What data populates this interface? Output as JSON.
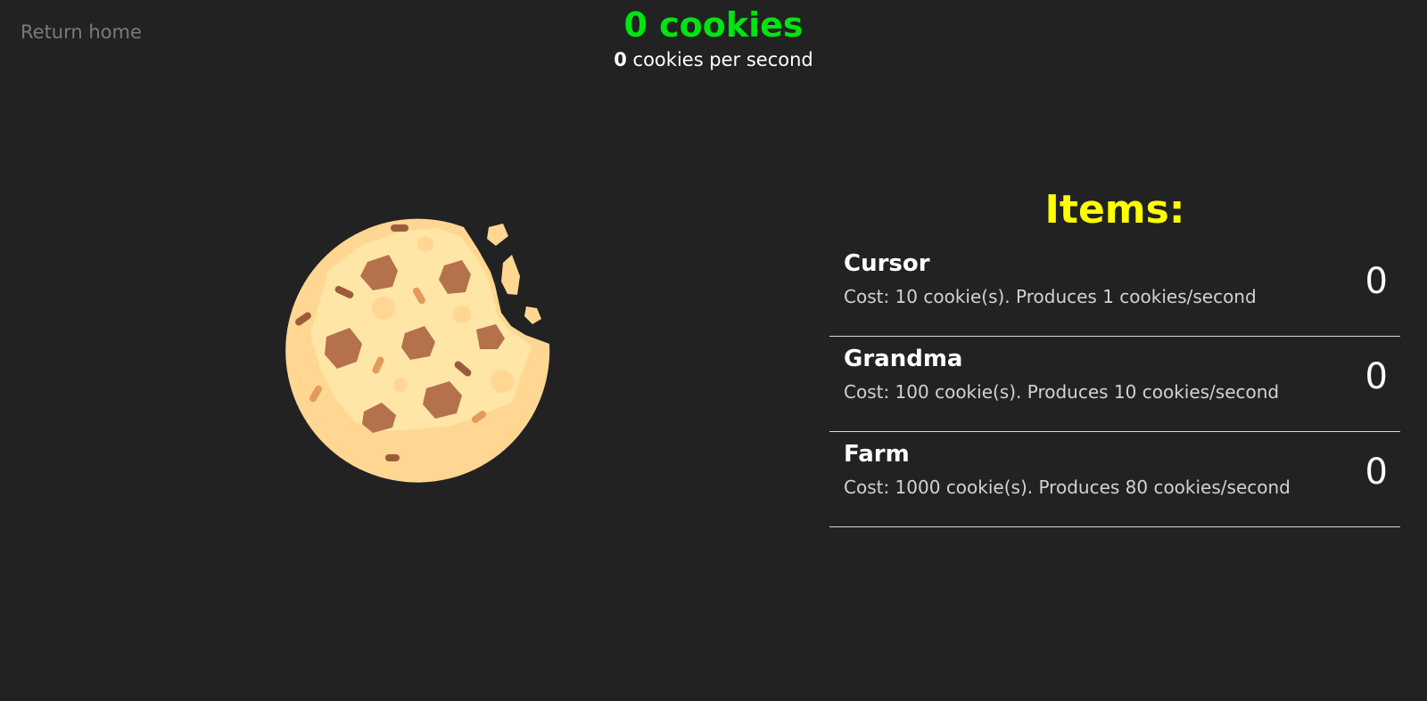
{
  "nav": {
    "return_home": "Return home"
  },
  "header": {
    "cookie_count": "0 cookies",
    "cps_value": "0",
    "cps_suffix": " cookies per second"
  },
  "cookie": {
    "icon": "cookie-icon"
  },
  "items": {
    "title": "Items:",
    "list": [
      {
        "name": "Cursor",
        "desc": "Cost: 10 cookie(s). Produces 1 cookies/second",
        "owned": "0"
      },
      {
        "name": "Grandma",
        "desc": "Cost: 100 cookie(s). Produces 10 cookies/second",
        "owned": "0"
      },
      {
        "name": "Farm",
        "desc": "Cost: 1000 cookie(s). Produces 80 cookies/second",
        "owned": "0"
      }
    ]
  },
  "colors": {
    "background": "#222222",
    "cookie_count": "#00e40f",
    "items_title": "#ffff00",
    "return_home": "#7a7a7a",
    "cookie_dough": "#ffe3a0",
    "cookie_chip": "#b5704c"
  }
}
